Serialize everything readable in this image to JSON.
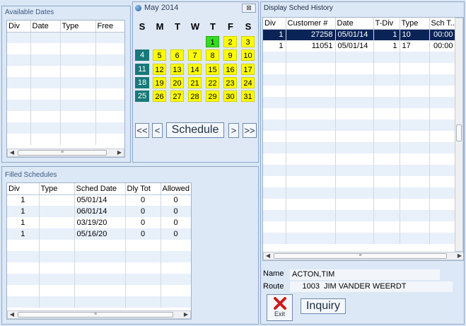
{
  "available_dates": {
    "title": "Available Dates",
    "columns": [
      "Div",
      "Date",
      "Type",
      "Free"
    ]
  },
  "calendar": {
    "title": "May 2014",
    "close_glyph": "⊠",
    "dow": [
      "S",
      "M",
      "T",
      "W",
      "T",
      "F",
      "S"
    ],
    "weeks": [
      {
        "label": "",
        "days": [
          "",
          "",
          "",
          "",
          "1",
          "2",
          "3"
        ]
      },
      {
        "label": "4",
        "days": [
          "5",
          "6",
          "7",
          "8",
          "9",
          "10"
        ]
      },
      {
        "label": "11",
        "days": [
          "12",
          "13",
          "14",
          "15",
          "16",
          "17"
        ]
      },
      {
        "label": "18",
        "days": [
          "19",
          "20",
          "21",
          "22",
          "23",
          "24"
        ]
      },
      {
        "label": "25",
        "days": [
          "26",
          "27",
          "28",
          "29",
          "30",
          "31"
        ]
      }
    ],
    "nav": {
      "first": "<<",
      "prev": "<",
      "schedule": "Schedule",
      "next": ">",
      "last": ">>"
    }
  },
  "filled_schedules": {
    "title": "Filled Schedules",
    "columns": [
      "Div",
      "Type",
      "Sched Date",
      "Dly Tot",
      "Allowed"
    ],
    "rows": [
      [
        "1",
        "",
        "05/01/14",
        "0",
        "0"
      ],
      [
        "1",
        "",
        "06/01/14",
        "0",
        "0"
      ],
      [
        "1",
        "",
        "03/19/20",
        "0",
        "0"
      ],
      [
        "1",
        "",
        "05/16/20",
        "0",
        "0"
      ]
    ]
  },
  "history": {
    "title": "Display Sched History",
    "columns": [
      "Div",
      "Customer #",
      "Date",
      "T-Div",
      "Type",
      "Sch T..."
    ],
    "rows": [
      [
        "1",
        "27258",
        "05/01/14",
        "1",
        "10",
        "00:00"
      ],
      [
        "1",
        "11051",
        "05/01/14",
        "1",
        "17",
        "00:00"
      ]
    ]
  },
  "details": {
    "name_label": "Name",
    "name_value": "ACTON,TIM",
    "route_label": "Route",
    "route_number": "1003",
    "route_name": "JIM VANDER WEERDT"
  },
  "buttons": {
    "exit_label": "Exit",
    "inquiry_label": "Inquiry"
  },
  "scroll_glyphs": {
    "left": "◀",
    "right": "▶",
    "grip": "≡"
  },
  "colors": {
    "selected_row": "#0b2458",
    "weekday": "#fdfd00",
    "today": "#33dd22",
    "week_label": "#19797a",
    "exit_x": "#cc1a1a"
  }
}
